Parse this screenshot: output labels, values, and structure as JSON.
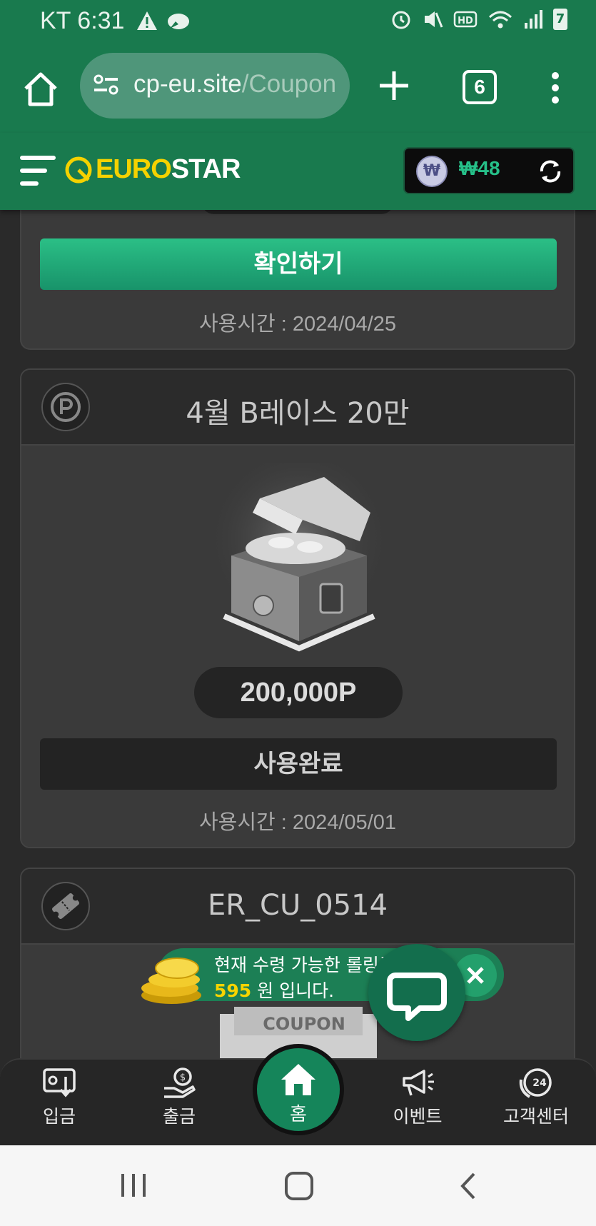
{
  "status_bar": {
    "carrier_time": "KT 6:31",
    "battery": "7"
  },
  "browser": {
    "url_host": "cp-eu.site",
    "url_path": "/Coupon",
    "tab_count": "6"
  },
  "header": {
    "logo_part1": "EURO",
    "logo_part2": "STAR",
    "currency_icon": "₩",
    "balance": "₩48"
  },
  "cards": [
    {
      "button_label": "확인하기",
      "used_time": "사용시간 : 2024/04/25"
    },
    {
      "title": "4월 B레이스 20만",
      "points": "200,000P",
      "button_label": "사용완료",
      "used_time": "사용시간 : 2024/05/01"
    },
    {
      "title": "ER_CU_0514",
      "peek_label": "COUPON"
    }
  ],
  "promo": {
    "line1": "현재 수령 가능한 롤링금",
    "amount": "595",
    "line2_suffix": " 원 입니다."
  },
  "bottom_nav": [
    {
      "label": "입금",
      "icon": "deposit-icon"
    },
    {
      "label": "출금",
      "icon": "withdraw-icon"
    },
    {
      "label": "홈",
      "icon": "home-icon"
    },
    {
      "label": "이벤트",
      "icon": "megaphone-icon"
    },
    {
      "label": "고객센터",
      "icon": "support-24-icon"
    }
  ],
  "colors": {
    "brand_green": "#197a4e",
    "accent_green": "#26c089",
    "logo_yellow": "#f5d200",
    "panel_dark": "#2f2f2f"
  }
}
